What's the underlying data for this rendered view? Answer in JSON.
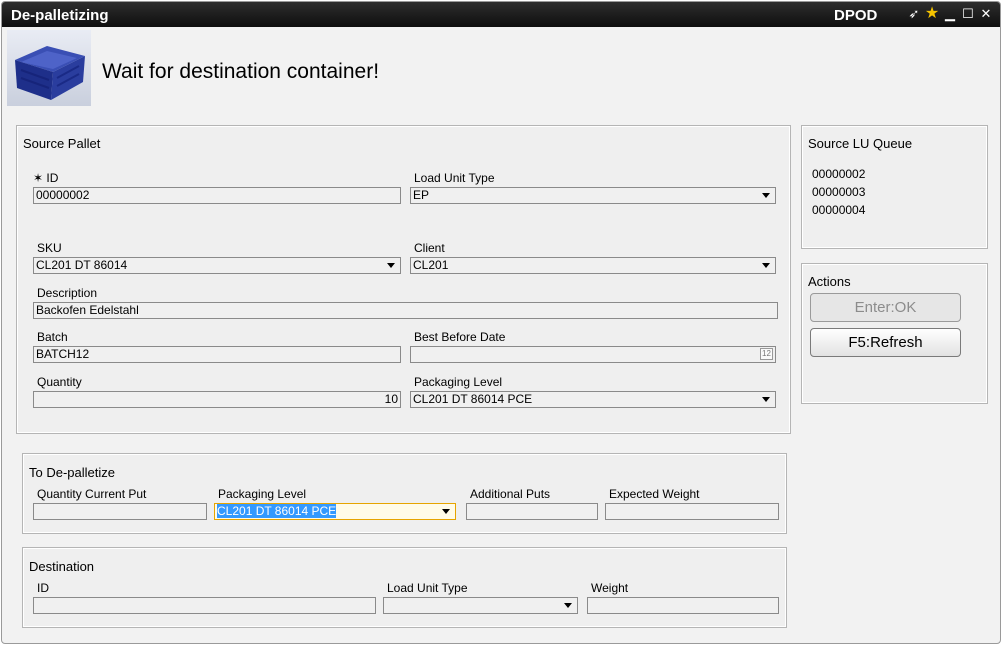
{
  "window": {
    "title": "De-palletizing",
    "app_name": "DPOD"
  },
  "titlebar_icons": [
    "pin-icon",
    "star-icon",
    "minimize-icon",
    "maximize-icon",
    "close-icon"
  ],
  "titlebar_glyphs": {
    "pin": "➶",
    "star": "★",
    "minimize": "▁",
    "maximize": "☐",
    "close": "✕"
  },
  "header": {
    "message": "Wait for destination container!",
    "image": "blue-crate-image"
  },
  "source_pallet": {
    "title": "Source Pallet",
    "id": {
      "label": "ID",
      "required_mark": "✶",
      "value": "00000002"
    },
    "load_unit_type": {
      "label": "Load Unit Type",
      "value": "EP"
    },
    "sku": {
      "label": "SKU",
      "value": "CL201 DT 86014"
    },
    "client": {
      "label": "Client",
      "value": "CL201"
    },
    "description": {
      "label": "Description",
      "value": "Backofen Edelstahl"
    },
    "batch": {
      "label": "Batch",
      "value": "BATCH12"
    },
    "best_before_date": {
      "label": "Best Before Date",
      "value": "",
      "calendar_glyph": "12"
    },
    "quantity": {
      "label": "Quantity",
      "value": "10"
    },
    "packaging_level": {
      "label": "Packaging Level",
      "value": "CL201 DT 86014 PCE"
    }
  },
  "to_depalletize": {
    "title": "To De-palletize",
    "quantity_current_put": {
      "label": "Quantity Current Put",
      "value": ""
    },
    "packaging_level": {
      "label": "Packaging Level",
      "value": "CL201 DT 86014 PCE"
    },
    "additional_puts": {
      "label": "Additional Puts",
      "value": ""
    },
    "expected_weight": {
      "label": "Expected Weight",
      "value": ""
    }
  },
  "destination": {
    "title": "Destination",
    "id": {
      "label": "ID",
      "value": ""
    },
    "load_unit_type": {
      "label": "Load Unit Type",
      "value": ""
    },
    "weight": {
      "label": "Weight",
      "value": ""
    }
  },
  "source_lu_queue": {
    "title": "Source LU Queue",
    "items": [
      "00000002",
      "00000003",
      "00000004"
    ]
  },
  "actions": {
    "title": "Actions",
    "ok_button": {
      "label": "Enter:OK",
      "enabled": false
    },
    "refresh_button": {
      "label": "F5:Refresh",
      "enabled": true
    }
  },
  "colors": {
    "titlebar": "#1a1a1a",
    "selection": "#3399ff",
    "focus_border": "#e6a400",
    "star": "#f5c400",
    "crate": "#1e2f8a"
  }
}
